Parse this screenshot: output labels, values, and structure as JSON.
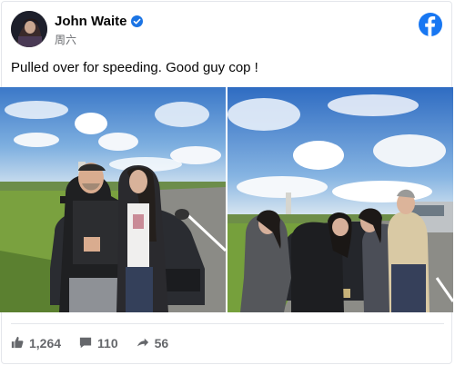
{
  "post": {
    "author": "John Waite",
    "timestamp": "周六",
    "text": "Pulled over for speeding. Good guy cop !",
    "photos": [
      {
        "name": "roadside-photo-with-officer"
      },
      {
        "name": "group-photo-at-police-car"
      }
    ]
  },
  "icons": {
    "verified": "verified-badge-icon",
    "brand": "facebook-logo-icon",
    "like": "thumbs-up-icon",
    "comment": "comment-icon",
    "share": "share-arrow-icon"
  },
  "stats": {
    "likes": "1,264",
    "comments": "110",
    "shares": "56"
  },
  "colors": {
    "brand": "#1877f2",
    "secondary_text": "#65676b",
    "verified": "#1b74e4"
  }
}
